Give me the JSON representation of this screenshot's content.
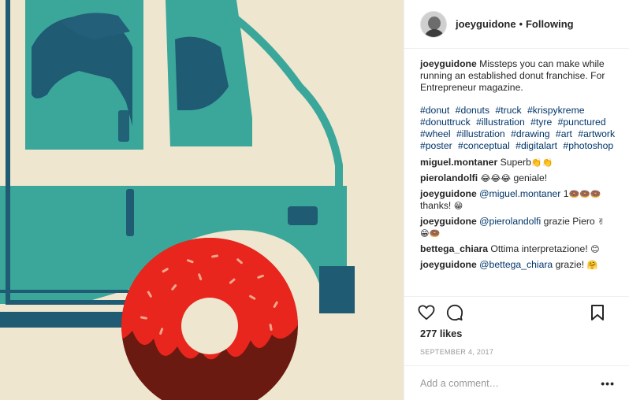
{
  "post": {
    "username": "joeyguidone",
    "separator": "•",
    "follow_status": "Following",
    "caption": {
      "username": "joeyguidone",
      "text": "Missteps you can make while running an established donut franchise. For Entrepreneur magazine."
    },
    "hashtags": [
      "#donut",
      "#donuts",
      "#truck",
      "#krispykreme",
      "#donuttruck",
      "#illustration",
      "#tyre",
      "#punctured",
      "#wheel",
      "#illustration",
      "#drawing",
      "#art",
      "#artwork",
      "#poster",
      "#conceptual",
      "#digitalart",
      "#photoshop"
    ],
    "comments": [
      {
        "user": "miguel.montaner",
        "mention": "",
        "text": "Superb",
        "emoji": "👏👏"
      },
      {
        "user": "pierolandolfi",
        "mention": "",
        "text": "geniale!",
        "emoji_before": "😂😂😂"
      },
      {
        "user": "joeyguidone",
        "mention": "@miguel.montaner",
        "text": "1",
        "emoji": "🍩🍩🍩",
        "text_after": "thanks!",
        "emoji_after": "😁"
      },
      {
        "user": "joeyguidone",
        "mention": "@pierolandolfi",
        "text": "grazie Piero",
        "emoji": "✌",
        "text_after": "",
        "emoji_after": "😁🍩"
      },
      {
        "user": "bettega_chiara",
        "mention": "",
        "text": "Ottima interpretazione!",
        "emoji": "😊"
      },
      {
        "user": "joeyguidone",
        "mention": "@bettega_chiara",
        "text": "grazie!",
        "emoji": "🤗"
      }
    ],
    "likes": "277 likes",
    "date": "September 4, 2017",
    "add_comment_placeholder": "Add a comment…",
    "more_label": "•••",
    "icons": {
      "like": "heart-icon",
      "comment": "speech-bubble-icon",
      "save": "bookmark-icon",
      "more": "ellipsis-icon"
    }
  },
  "colors": {
    "background": "#efe6cf",
    "truck_teal": "#3aa79a",
    "truck_dark": "#1f5b73",
    "icing_red": "#e8261d",
    "donut_brown": "#6b1a12",
    "link": "#003569"
  }
}
